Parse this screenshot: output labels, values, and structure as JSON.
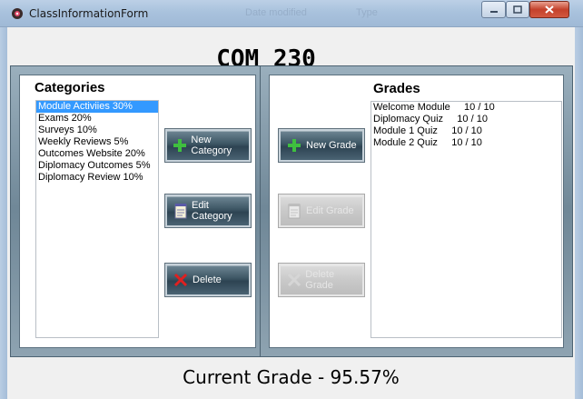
{
  "window": {
    "title": "ClassInformationForm",
    "ghost_labels": [
      "Date modified",
      "Type"
    ]
  },
  "course": {
    "name": "COM 230"
  },
  "categories": {
    "heading": "Categories",
    "items": [
      {
        "label": "Module Activiies  30%",
        "selected": true
      },
      {
        "label": "Exams  20%",
        "selected": false
      },
      {
        "label": "Surveys  10%",
        "selected": false
      },
      {
        "label": "Weekly Reviews  5%",
        "selected": false
      },
      {
        "label": "Outcomes Website  20%",
        "selected": false
      },
      {
        "label": "Diplomacy Outcomes  5%",
        "selected": false
      },
      {
        "label": "Diplomacy Review  10%",
        "selected": false
      }
    ],
    "buttons": {
      "new": {
        "label": "New Category",
        "icon": "plus-icon"
      },
      "edit": {
        "label": "Edit Category",
        "icon": "notepad-icon"
      },
      "delete": {
        "label": "Delete",
        "icon": "x-icon"
      }
    }
  },
  "grades": {
    "heading": "Grades",
    "items": [
      {
        "label": "Welcome Module     10 / 10"
      },
      {
        "label": "Diplomacy Quiz     10 / 10"
      },
      {
        "label": "Module 1 Quiz     10 / 10"
      },
      {
        "label": "Module 2 Quiz     10 / 10"
      }
    ],
    "buttons": {
      "new": {
        "label": "New Grade",
        "icon": "plus-icon",
        "enabled": true
      },
      "edit": {
        "label": "Edit Grade",
        "icon": "notepad-icon",
        "enabled": false
      },
      "delete": {
        "label": "Delete Grade",
        "icon": "x-icon",
        "enabled": false
      }
    }
  },
  "footer": {
    "current_grade": "Current Grade - 95.57%"
  },
  "colors": {
    "selection": "#3399ff",
    "button_dark": "#2d4352",
    "panel_frame": "#6f8797"
  }
}
